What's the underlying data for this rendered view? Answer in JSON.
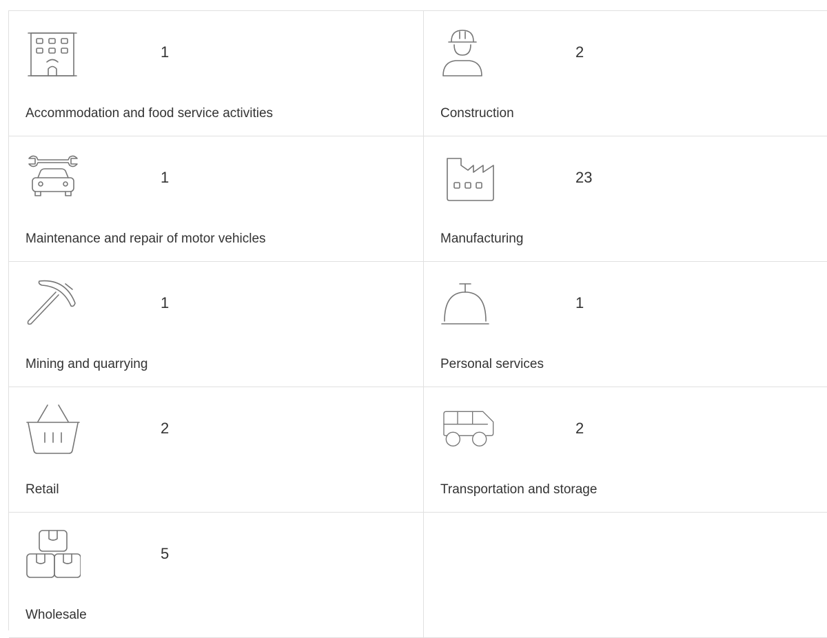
{
  "sectors": [
    {
      "label": "Accommodation and food service activities",
      "count": "1",
      "icon": "hotel-building-icon"
    },
    {
      "label": "Construction",
      "count": "2",
      "icon": "construction-worker-icon"
    },
    {
      "label": "Maintenance and repair of motor vehicles",
      "count": "1",
      "icon": "car-repair-wrench-icon"
    },
    {
      "label": "Manufacturing",
      "count": "23",
      "icon": "factory-icon"
    },
    {
      "label": "Mining and quarrying",
      "count": "1",
      "icon": "pickaxe-icon"
    },
    {
      "label": "Personal services",
      "count": "1",
      "icon": "service-bell-icon"
    },
    {
      "label": "Retail",
      "count": "2",
      "icon": "shopping-basket-icon"
    },
    {
      "label": "Transportation and storage",
      "count": "2",
      "icon": "van-icon"
    },
    {
      "label": "Wholesale",
      "count": "5",
      "icon": "stacked-boxes-icon"
    }
  ],
  "colors": {
    "icon_stroke": "#757575",
    "text": "#333333",
    "divider": "#e0e0e0"
  }
}
